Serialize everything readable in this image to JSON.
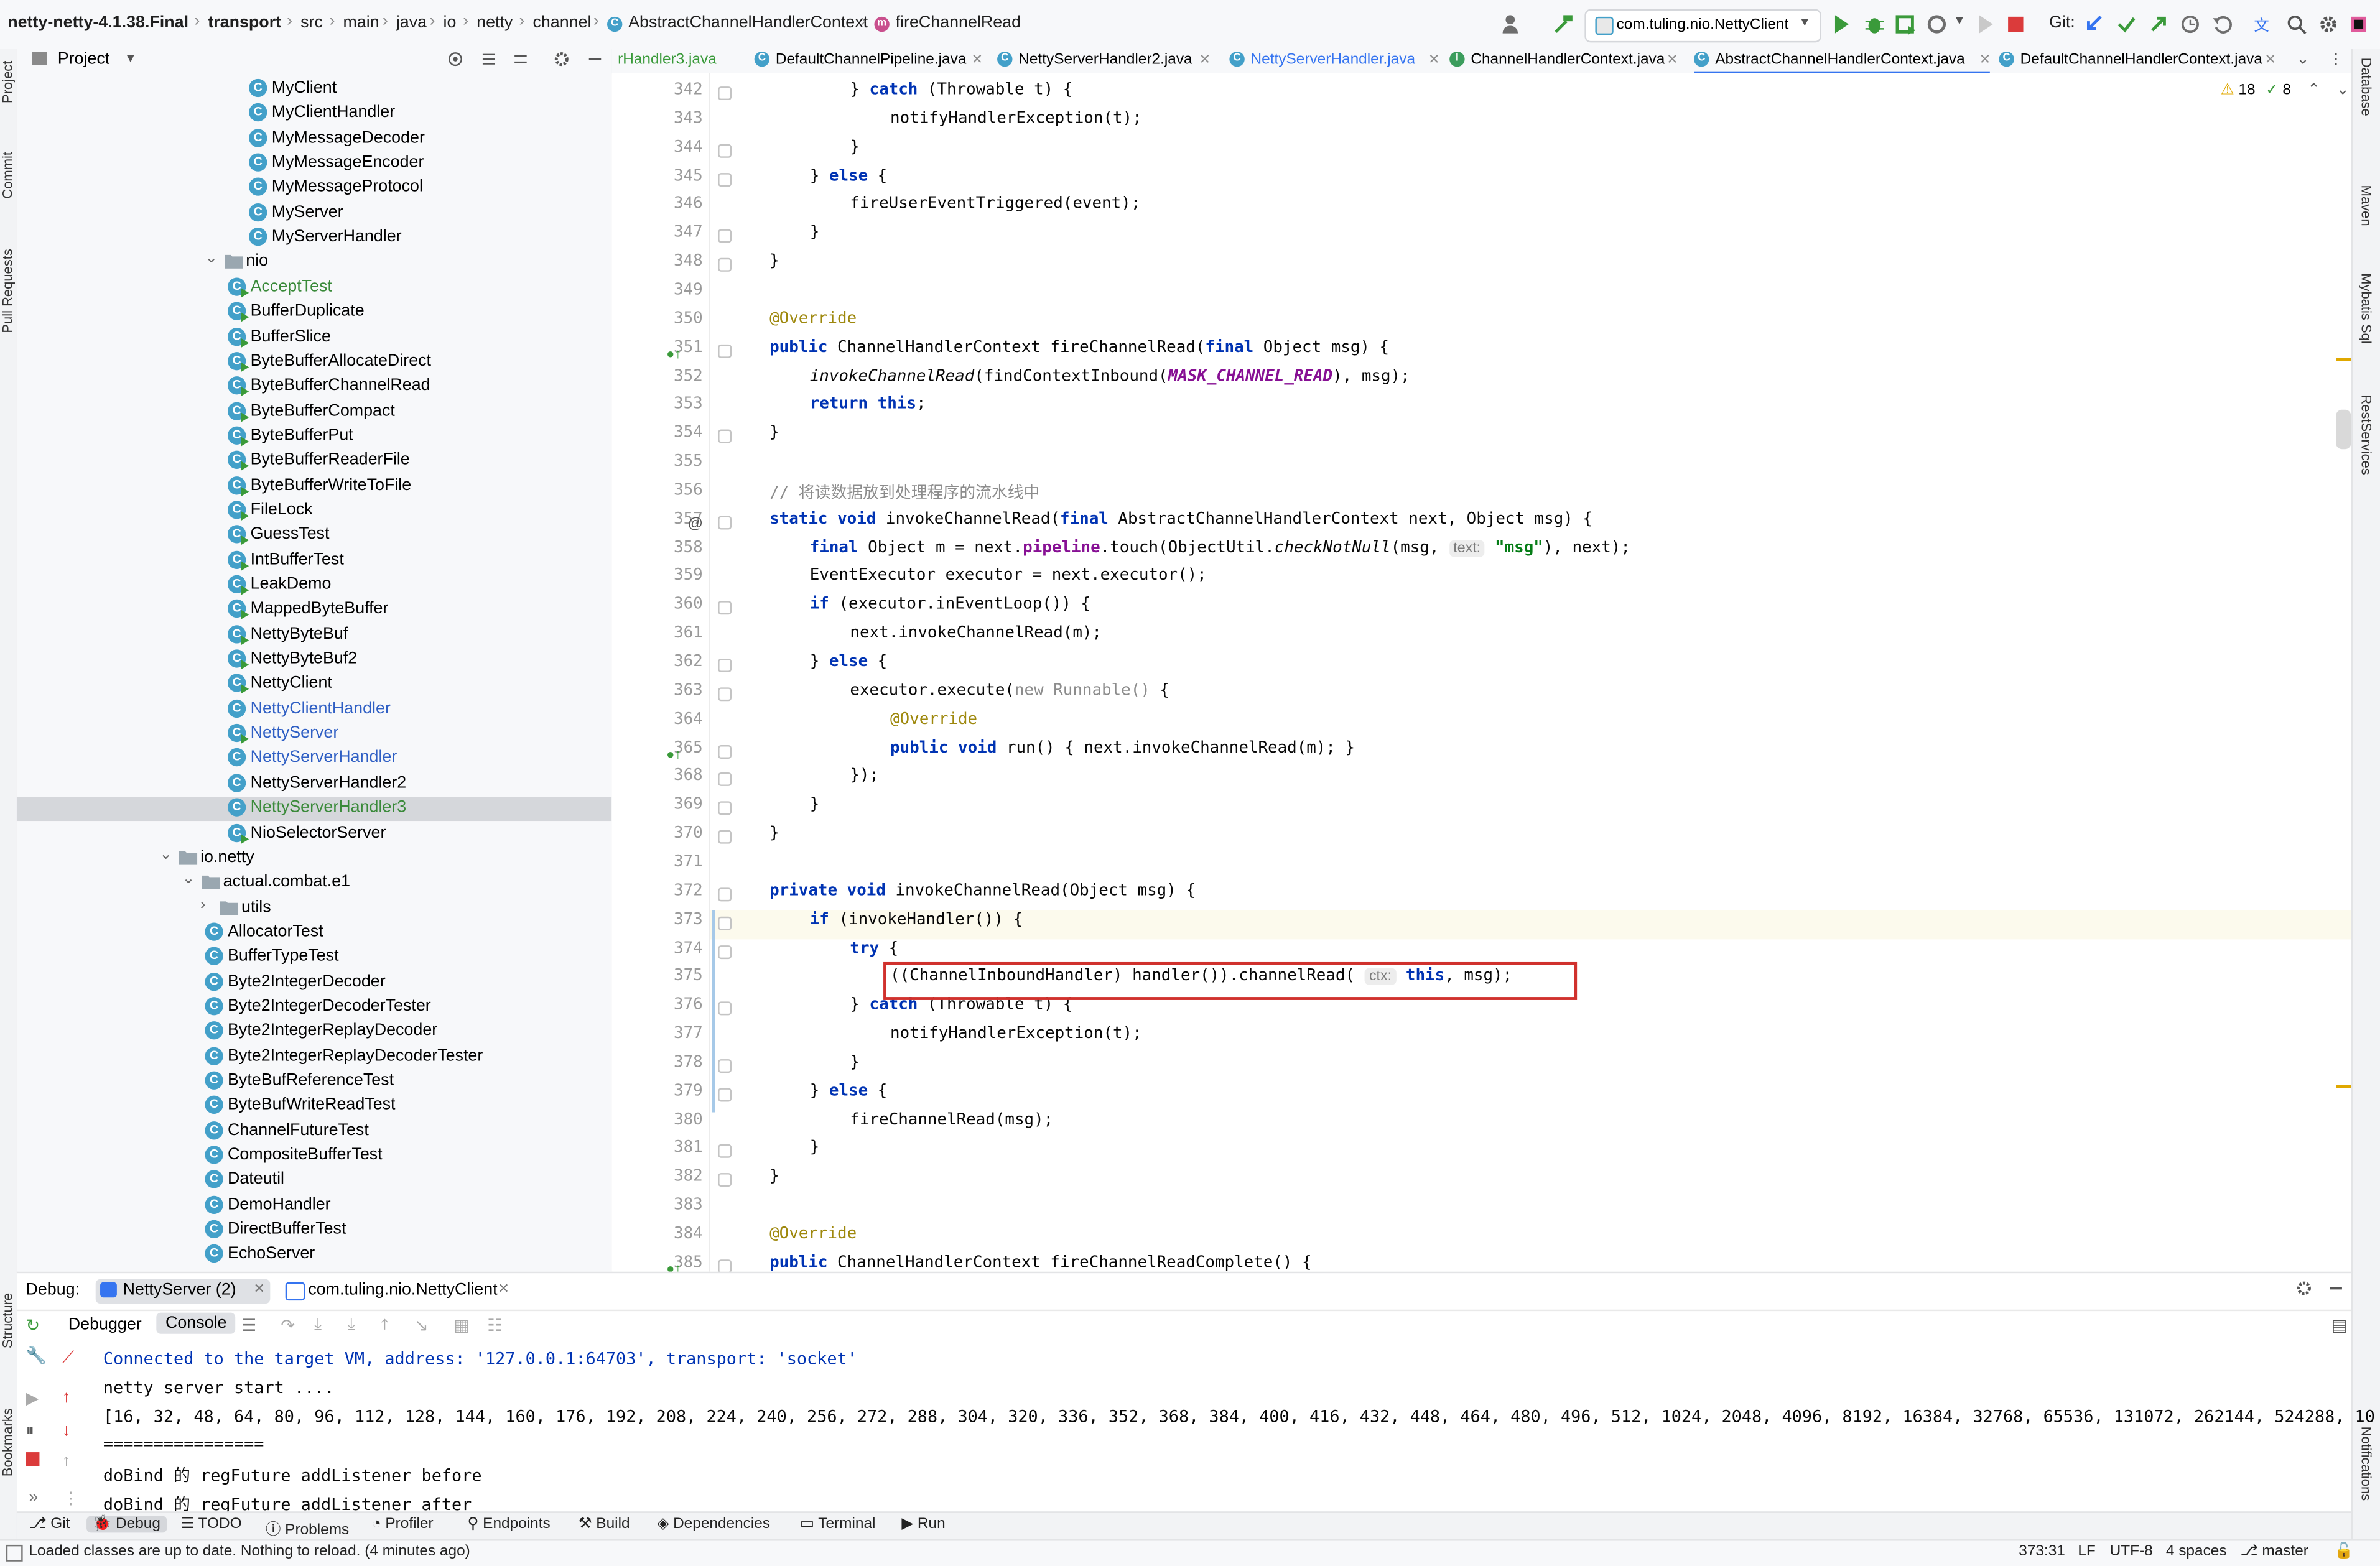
{
  "nav": {
    "project": "netty-netty-4.1.38.Final",
    "crumbs": [
      "transport",
      "src",
      "main",
      "java",
      "io",
      "netty",
      "channel",
      "AbstractChannelHandlerContext",
      "fireChannelRead"
    ],
    "run_config": "com.tuling.nio.NettyClient",
    "git_label": "Git:"
  },
  "project_panel": {
    "title": "Project",
    "items": [
      {
        "label": "MyClient",
        "kind": "class"
      },
      {
        "label": "MyClientHandler",
        "kind": "class"
      },
      {
        "label": "MyMessageDecoder",
        "kind": "class"
      },
      {
        "label": "MyMessageEncoder",
        "kind": "class"
      },
      {
        "label": "MyMessageProtocol",
        "kind": "class"
      },
      {
        "label": "MyServer",
        "kind": "class"
      },
      {
        "label": "MyServerHandler",
        "kind": "class"
      },
      {
        "label": "nio",
        "kind": "folder"
      },
      {
        "label": "AcceptTest",
        "kind": "run"
      },
      {
        "label": "BufferDuplicate",
        "kind": "run"
      },
      {
        "label": "BufferSlice",
        "kind": "run"
      },
      {
        "label": "ByteBufferAllocateDirect",
        "kind": "run"
      },
      {
        "label": "ByteBufferChannelRead",
        "kind": "run"
      },
      {
        "label": "ByteBufferCompact",
        "kind": "run"
      },
      {
        "label": "ByteBufferPut",
        "kind": "run"
      },
      {
        "label": "ByteBufferReaderFile",
        "kind": "run"
      },
      {
        "label": "ByteBufferWriteToFile",
        "kind": "run"
      },
      {
        "label": "FileLock",
        "kind": "run"
      },
      {
        "label": "GuessTest",
        "kind": "run"
      },
      {
        "label": "IntBufferTest",
        "kind": "run"
      },
      {
        "label": "LeakDemo",
        "kind": "run"
      },
      {
        "label": "MappedByteBuffer",
        "kind": "run"
      },
      {
        "label": "NettyByteBuf",
        "kind": "run"
      },
      {
        "label": "NettyByteBuf2",
        "kind": "run"
      },
      {
        "label": "NettyClient",
        "kind": "run"
      },
      {
        "label": "NettyClientHandler",
        "kind": "class"
      },
      {
        "label": "NettyServer",
        "kind": "run"
      },
      {
        "label": "NettyServerHandler",
        "kind": "class"
      },
      {
        "label": "NettyServerHandler2",
        "kind": "class"
      },
      {
        "label": "NettyServerHandler3",
        "kind": "class"
      },
      {
        "label": "NioSelectorServer",
        "kind": "run"
      },
      {
        "label": "io.netty",
        "kind": "folder"
      },
      {
        "label": "actual.combat.e1",
        "kind": "folder"
      },
      {
        "label": "utils",
        "kind": "folder"
      },
      {
        "label": "AllocatorTest",
        "kind": "class"
      },
      {
        "label": "BufferTypeTest",
        "kind": "class"
      },
      {
        "label": "Byte2IntegerDecoder",
        "kind": "class"
      },
      {
        "label": "Byte2IntegerDecoderTester",
        "kind": "class"
      },
      {
        "label": "Byte2IntegerReplayDecoder",
        "kind": "class"
      },
      {
        "label": "Byte2IntegerReplayDecoderTester",
        "kind": "class"
      },
      {
        "label": "ByteBufReferenceTest",
        "kind": "class"
      },
      {
        "label": "ByteBufWriteReadTest",
        "kind": "class"
      },
      {
        "label": "ChannelFutureTest",
        "kind": "class"
      },
      {
        "label": "CompositeBufferTest",
        "kind": "class"
      },
      {
        "label": "Dateutil",
        "kind": "class"
      },
      {
        "label": "DemoHandler",
        "kind": "class"
      },
      {
        "label": "DirectBufferTest",
        "kind": "class"
      },
      {
        "label": "EchoServer",
        "kind": "class"
      }
    ]
  },
  "tabs": [
    {
      "label": "rHandler3.java",
      "kind": "class"
    },
    {
      "label": "DefaultChannelPipeline.java",
      "kind": "class"
    },
    {
      "label": "NettyServerHandler2.java",
      "kind": "class"
    },
    {
      "label": "NettyServerHandler.java",
      "kind": "class"
    },
    {
      "label": "ChannelHandlerContext.java",
      "kind": "iface"
    },
    {
      "label": "AbstractChannelHandlerContext.java",
      "kind": "class"
    },
    {
      "label": "DefaultChannelHandlerContext.java",
      "kind": "class"
    }
  ],
  "editor": {
    "warnings": "18",
    "weak_warnings": "8",
    "line_numbers": [
      "342",
      "343",
      "344",
      "345",
      "346",
      "347",
      "348",
      "349",
      "350",
      "351",
      "352",
      "353",
      "354",
      "355",
      "356",
      "357",
      "358",
      "359",
      "360",
      "361",
      "362",
      "363",
      "364",
      "365",
      "368",
      "369",
      "370",
      "371",
      "372",
      "373",
      "374",
      "375",
      "376",
      "377",
      "378",
      "379",
      "380",
      "381",
      "382",
      "383",
      "384",
      "385"
    ],
    "lines": [
      "} catch (Throwable t) {",
      "notifyHandlerException(t);",
      "}",
      "} else {",
      "fireUserEventTriggered(event);",
      "}",
      "}",
      "",
      "@Override",
      "public ChannelHandlerContext fireChannelRead(final Object msg) {",
      "invokeChannelRead(findContextInbound(MASK_CHANNEL_READ), msg);",
      "return this;",
      "}",
      "",
      "// 将读数据放到处理程序的流水线中",
      "static void invokeChannelRead(final AbstractChannelHandlerContext next, Object msg) {",
      "final Object m = next.pipeline.touch(ObjectUtil.checkNotNull(msg, text: \"msg\"), next);",
      "EventExecutor executor = next.executor();",
      "if (executor.inEventLoop()) {",
      "next.invokeChannelRead(m);",
      "} else {",
      "executor.execute(new Runnable() {",
      "@Override",
      "public void run() { next.invokeChannelRead(m); }",
      "});",
      "}",
      "}",
      "",
      "private void invokeChannelRead(Object msg) {",
      "if (invokeHandler()) {",
      "try {",
      "((ChannelInboundHandler) handler()).channelRead( ctx: this, msg);",
      "} catch (Throwable t) {",
      "notifyHandlerException(t);",
      "}",
      "} else {",
      "fireChannelRead(msg);",
      "}",
      "}",
      "",
      "@Override",
      "public ChannelHandlerContext fireChannelReadComplete() {"
    ]
  },
  "debug": {
    "label": "Debug:",
    "sessions": [
      "NettyServer (2)",
      "com.tuling.nio.NettyClient"
    ],
    "subtabs": [
      "Debugger",
      "Console"
    ],
    "console": [
      "Connected to the target VM, address: '127.0.0.1:64703', transport: 'socket'",
      "netty server start ....",
      "[16, 32, 48, 64, 80, 96, 112, 128, 144, 160, 176, 192, 208, 224, 240, 256, 272, 288, 304, 320, 336, 352, 368, 384, 400, 416, 432, 448, 464, 480, 496, 512, 1024, 2048, 4096, 8192, 16384, 32768, 65536, 131072, 262144, 524288, 10",
      "================",
      "doBind 的 regFuture addListener before",
      "doBind 的 regFuture addListener after"
    ]
  },
  "toolwindows": [
    "Git",
    "Debug",
    "TODO",
    "Problems",
    "Profiler",
    "Endpoints",
    "Build",
    "Dependencies",
    "Terminal",
    "Run"
  ],
  "left_strip": [
    "Project",
    "Commit",
    "Pull Requests",
    "Structure",
    "Bookmarks"
  ],
  "right_strip": [
    "Database",
    "Maven",
    "Mybatis Sql",
    "RestServices",
    "Notifications"
  ],
  "status": {
    "message": "Loaded classes are up to date. Nothing to reload. (4 minutes ago)",
    "position": "373:31",
    "line_sep": "LF",
    "encoding": "UTF-8",
    "indent": "4 spaces",
    "branch": "master"
  },
  "colors": {
    "accent": "#3574f0",
    "highlight_box": "#d0312d",
    "keyword": "#0033b3",
    "annotation": "#9e880d",
    "string": "#067d17"
  }
}
